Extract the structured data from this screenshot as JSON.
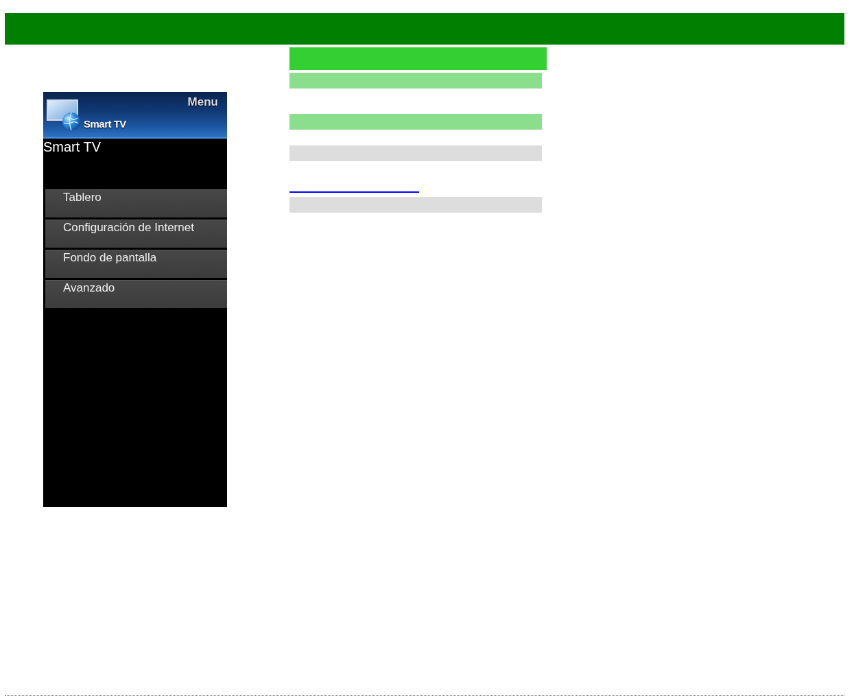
{
  "tv_menu": {
    "header": {
      "app_label": "Smart TV",
      "menu_label": "Menu"
    },
    "title": "Smart TV",
    "items": [
      {
        "label": "Tablero",
        "selected": false
      },
      {
        "label": "Configuración de Internet",
        "selected": false
      },
      {
        "label": "Fondo de pantalla",
        "selected": false
      },
      {
        "label": "Avanzado",
        "selected": false
      }
    ]
  }
}
